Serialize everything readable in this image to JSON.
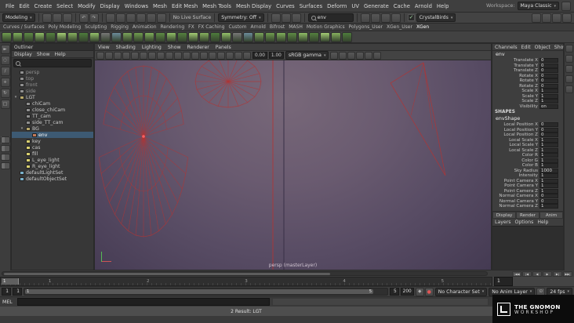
{
  "menubar": {
    "items": [
      "File",
      "Edit",
      "Create",
      "Select",
      "Modify",
      "Display",
      "Windows",
      "Mesh",
      "Edit Mesh",
      "Mesh Tools",
      "Mesh Display",
      "Curves",
      "Surfaces",
      "Deform",
      "UV",
      "Generate",
      "Cache",
      "Arnold",
      "Help"
    ],
    "workspace_label": "Workspace:",
    "workspace_value": "Maya Classic"
  },
  "status_line": {
    "menu_set": "Modeling",
    "no_live_surface": "No Live Surface",
    "symmetry": "Symmetry: Off",
    "search_value": "env",
    "character_dropdown": "CrystalBirds"
  },
  "shelf": {
    "tabs": [
      "Curves / Surfaces",
      "Poly Modeling",
      "Sculpting",
      "Rigging",
      "Animation",
      "Rendering",
      "FX",
      "FX Caching",
      "Custom",
      "Arnold",
      "Bifrost",
      "MASH",
      "Motion Graphics",
      "Polygons_User",
      "XGen_User",
      "XGen"
    ],
    "active_tab": "XGen"
  },
  "outliner": {
    "title": "Outliner",
    "menus": [
      "Display",
      "Show",
      "Help"
    ],
    "items": [
      {
        "label": "persp",
        "depth": 0,
        "icon": "camera",
        "dim": true
      },
      {
        "label": "top",
        "depth": 0,
        "icon": "camera",
        "dim": true
      },
      {
        "label": "front",
        "depth": 0,
        "icon": "camera",
        "dim": true
      },
      {
        "label": "side",
        "depth": 0,
        "icon": "camera",
        "dim": true
      },
      {
        "label": "LGT",
        "depth": 0,
        "icon": "group",
        "expanded": true
      },
      {
        "label": "chiCam",
        "depth": 1,
        "icon": "camera"
      },
      {
        "label": "close_chiCam",
        "depth": 1,
        "icon": "camera"
      },
      {
        "label": "TT_cam",
        "depth": 1,
        "icon": "camera"
      },
      {
        "label": "side_TT_cam",
        "depth": 1,
        "icon": "camera"
      },
      {
        "label": "BG",
        "depth": 1,
        "icon": "group",
        "expanded": true
      },
      {
        "label": "env",
        "depth": 2,
        "icon": "sphere",
        "selected": true
      },
      {
        "label": "key",
        "depth": 1,
        "icon": "light"
      },
      {
        "label": "cas",
        "depth": 1,
        "icon": "light"
      },
      {
        "label": "fill",
        "depth": 1,
        "icon": "light"
      },
      {
        "label": "L_eye_light",
        "depth": 1,
        "icon": "light"
      },
      {
        "label": "R_eye_light",
        "depth": 1,
        "icon": "light"
      },
      {
        "label": "defaultLightSet",
        "depth": 0,
        "icon": "set"
      },
      {
        "label": "defaultObjectSet",
        "depth": 0,
        "icon": "set"
      }
    ]
  },
  "viewport": {
    "menus": [
      "View",
      "Shading",
      "Lighting",
      "Show",
      "Renderer",
      "Panels"
    ],
    "exposure": "0.00",
    "gamma": "1.00",
    "color_transform": "sRGB gamma",
    "camera_label": "persp (masterLayer)"
  },
  "channel_box": {
    "menus": [
      "Channels",
      "Edit",
      "Object",
      "Show"
    ],
    "node": "env",
    "transform_rows": [
      [
        "Translate X",
        "0"
      ],
      [
        "Translate Y",
        "0"
      ],
      [
        "Translate Z",
        "0"
      ],
      [
        "Rotate X",
        "0"
      ],
      [
        "Rotate Y",
        "0"
      ],
      [
        "Rotate Z",
        "0"
      ],
      [
        "Scale X",
        "1"
      ],
      [
        "Scale Y",
        "1"
      ],
      [
        "Scale Z",
        "1"
      ],
      [
        "Visibility",
        "on"
      ]
    ],
    "shapes_header": "SHAPES",
    "shape_node": "envShape",
    "shape_rows": [
      [
        "Local Position X",
        "0"
      ],
      [
        "Local Position Y",
        "0"
      ],
      [
        "Local Position Z",
        "0"
      ],
      [
        "Local Scale X",
        "1"
      ],
      [
        "Local Scale Y",
        "1"
      ],
      [
        "Local Scale Z",
        "1"
      ],
      [
        "Color R",
        "1"
      ],
      [
        "Color G",
        "1"
      ],
      [
        "Color B",
        "1"
      ],
      [
        "Sky Radius",
        "1000"
      ],
      [
        "Intensity",
        "1"
      ],
      [
        "Point Camera X",
        "1"
      ],
      [
        "Point Camera Y",
        "1"
      ],
      [
        "Point Camera Z",
        "1"
      ],
      [
        "Normal Camera X",
        "0"
      ],
      [
        "Normal Camera Y",
        "0"
      ],
      [
        "Normal Camera Z",
        "1"
      ]
    ],
    "layer_tabs": [
      "Display",
      "Render",
      "Anim"
    ],
    "layer_menus": [
      "Layers",
      "Options",
      "Help"
    ]
  },
  "timeline": {
    "tick_labels": [
      "1",
      "2",
      "3",
      "4",
      "5"
    ],
    "current_frame": "1",
    "range_start": "1",
    "playback_start": "1",
    "playback_end": "5",
    "range_end": "200",
    "character_set": "No Character Set",
    "anim_layer": "No Anim Layer",
    "fps": "24 fps"
  },
  "command_line": {
    "label": "MEL",
    "help_text": "2 Result: LGT"
  },
  "branding": {
    "line1": "THE GNOMON",
    "line2": "WORKSHOP"
  },
  "icons": {
    "status_groups": [
      [
        "new-scene-icon",
        "open-scene-icon",
        "save-scene-icon"
      ],
      [
        "undo-icon",
        "redo-icon"
      ],
      [
        "snap-grid-icon",
        "snap-curve-icon",
        "snap-point-icon",
        "snap-projected-center-icon",
        "snap-view-plane-icon",
        "make-live-icon"
      ],
      [
        "input-connections-icon",
        "output-connections-icon",
        "construction-history-icon"
      ],
      [
        "render-current-frame-icon",
        "ipr-render-icon",
        "render-settings-icon",
        "display-render-globals-icon"
      ],
      [
        "toggle-modeling-toolkit-icon",
        "toggle-attribute-editor-icon",
        "toggle-tool-settings-icon",
        "toggle-channel-box-icon"
      ]
    ],
    "viewport_toolbar_left": [
      "select-camera-icon",
      "lock-camera-icon",
      "camera-attributes-icon",
      "bookmarks-icon",
      "image-plane-icon",
      "two-d-pan-zoom-icon",
      "grease-pencil-icon",
      "grid-icon",
      "film-gate-icon",
      "resolution-gate-icon",
      "gate-mask-icon",
      "field-chart-icon",
      "safe-action-icon",
      "safe-title-icon",
      "wireframe-icon",
      "shaded-icon",
      "textured-icon",
      "use-all-lights-icon"
    ],
    "viewport_toolbar_right": [
      "shadows-icon",
      "screen-space-ao-icon",
      "motion-blur-icon",
      "multisampling-icon",
      "isolate-select-icon",
      "xray-icon"
    ],
    "toolbox": [
      "select-tool-icon",
      "lasso-tool-icon",
      "paint-selection-tool-icon",
      "move-tool-icon",
      "rotate-tool-icon",
      "scale-tool-icon"
    ],
    "layout_shortcuts": [
      "layout-single-pane-icon",
      "layout-four-pane-icon",
      "layout-persp-outliner-icon",
      "layout-hypershade-icon"
    ],
    "sidebar": [
      "attribute-editor-tab-icon",
      "tool-settings-tab-icon",
      "channel-box-tab-icon",
      "modeling-toolkit-tab-icon",
      "xgen-tab-icon"
    ],
    "transport": [
      "goto-start-icon",
      "step-back-frame-icon",
      "play-backward-icon",
      "play-forward-icon",
      "step-forward-frame-icon",
      "goto-end-icon"
    ],
    "range_icons": [
      "set-key-icon",
      "auto-key-icon"
    ],
    "pref_icons": [
      "animation-preferences-icon"
    ]
  },
  "colors": {
    "accent": "#5285a6",
    "wireframe": "#b23434",
    "selection": "#3d5a73",
    "viewport_top": "#756579",
    "viewport_bottom": "#443a52"
  }
}
